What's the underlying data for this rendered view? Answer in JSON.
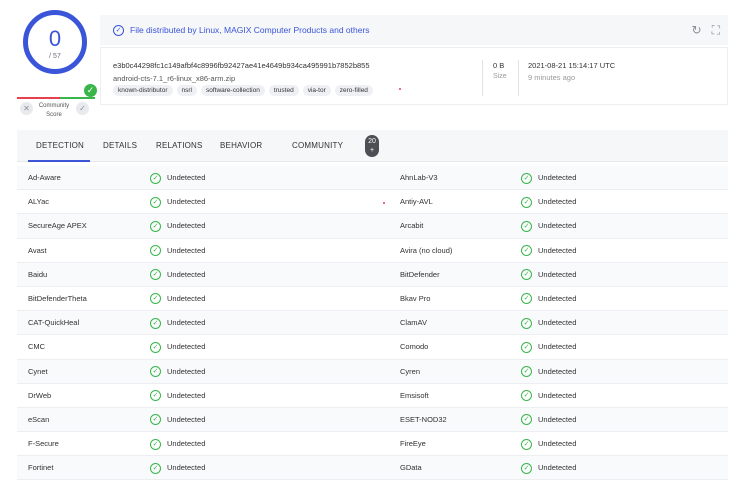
{
  "score": {
    "detections": "0",
    "total": "/ 57"
  },
  "community": {
    "label": "Community Score",
    "up_icon": "check-icon",
    "down_icon": "x-icon"
  },
  "banner": {
    "text": "File distributed by Linux, MAGIX Computer Products and others"
  },
  "file": {
    "hash": "e3b0c44298fc1c149afbf4c8996fb92427ae41e4649b934ca495991b7852b855",
    "name": "android-cts-7.1_r6-linux_x86-arm.zip",
    "tags": [
      "known-distributor",
      "nsrl",
      "software-collection",
      "trusted",
      "via-tor",
      "zero-filled"
    ],
    "size": "0 B",
    "size_label": "Size",
    "date": "2021-08-21 15:14:17 UTC",
    "date_ago": "9 minutes ago"
  },
  "tabs": [
    {
      "label": "DETECTION"
    },
    {
      "label": "DETAILS"
    },
    {
      "label": "RELATIONS"
    },
    {
      "label": "BEHAVIOR"
    },
    {
      "label": "COMMUNITY"
    }
  ],
  "community_count": "20",
  "community_count_sub": "+",
  "colors": {
    "accent": "#3b55d9",
    "clean": "#3ab549",
    "malicious": "#e8414e"
  },
  "detections": [
    {
      "engine1": "Ad-Aware",
      "result1": "Undetected",
      "engine2": "AhnLab-V3",
      "result2": "Undetected"
    },
    {
      "engine1": "ALYac",
      "result1": "Undetected",
      "engine2": "Antiy-AVL",
      "result2": "Undetected"
    },
    {
      "engine1": "SecureAge APEX",
      "result1": "Undetected",
      "engine2": "Arcabit",
      "result2": "Undetected"
    },
    {
      "engine1": "Avast",
      "result1": "Undetected",
      "engine2": "Avira (no cloud)",
      "result2": "Undetected"
    },
    {
      "engine1": "Baidu",
      "result1": "Undetected",
      "engine2": "BitDefender",
      "result2": "Undetected"
    },
    {
      "engine1": "BitDefenderTheta",
      "result1": "Undetected",
      "engine2": "Bkav Pro",
      "result2": "Undetected"
    },
    {
      "engine1": "CAT-QuickHeal",
      "result1": "Undetected",
      "engine2": "ClamAV",
      "result2": "Undetected"
    },
    {
      "engine1": "CMC",
      "result1": "Undetected",
      "engine2": "Comodo",
      "result2": "Undetected"
    },
    {
      "engine1": "Cynet",
      "result1": "Undetected",
      "engine2": "Cyren",
      "result2": "Undetected"
    },
    {
      "engine1": "DrWeb",
      "result1": "Undetected",
      "engine2": "Emsisoft",
      "result2": "Undetected"
    },
    {
      "engine1": "eScan",
      "result1": "Undetected",
      "engine2": "ESET-NOD32",
      "result2": "Undetected"
    },
    {
      "engine1": "F-Secure",
      "result1": "Undetected",
      "engine2": "FireEye",
      "result2": "Undetected"
    },
    {
      "engine1": "Fortinet",
      "result1": "Undetected",
      "engine2": "GData",
      "result2": "Undetected"
    }
  ]
}
